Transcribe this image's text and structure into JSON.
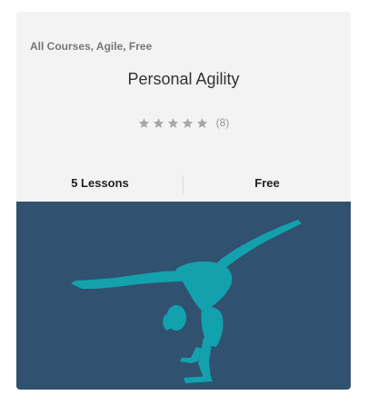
{
  "course": {
    "categories": "All Courses, Agile, Free",
    "title": "Personal Agility",
    "rating": {
      "stars": 5,
      "filled": 0,
      "count": "(8)"
    },
    "lessons": "5 Lessons",
    "price": "Free"
  },
  "colors": {
    "banner": "#305170",
    "figure": "#13a2ad",
    "star": "#a7a7a7"
  },
  "banner": {
    "icon": "gymnast-handstand-split-icon"
  }
}
